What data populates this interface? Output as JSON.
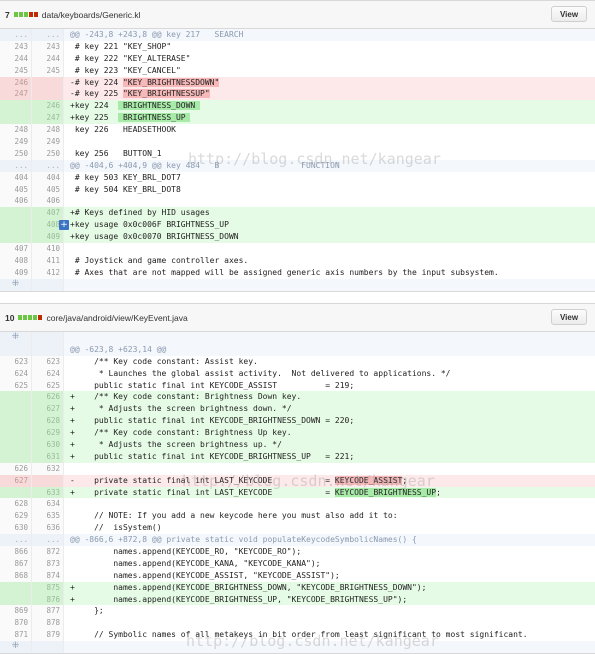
{
  "files": [
    {
      "count": "7",
      "bars": [
        "#6cc644",
        "#6cc644",
        "#6cc644",
        "#bd2c00",
        "#bd2c00"
      ],
      "path": "data/keyboards/Generic.kl",
      "view_label": "View",
      "rows": [
        {
          "t": "hunk",
          "o": "...",
          "n": "...",
          "c": "@@ -243,8 +243,8 @@ key 217   SEARCH"
        },
        {
          "t": "ctx",
          "o": "243",
          "n": "243",
          "c": " # key 221 \"KEY_SHOP\""
        },
        {
          "t": "ctx",
          "o": "244",
          "n": "244",
          "c": " # key 222 \"KEY_ALTERASE\""
        },
        {
          "t": "ctx",
          "o": "245",
          "n": "245",
          "c": " # key 223 \"KEY_CANCEL\""
        },
        {
          "t": "del",
          "o": "246",
          "n": "",
          "pre": "-# key 224 ",
          "hl": "\"KEY_BRIGHTNESSDOWN\"",
          "post": ""
        },
        {
          "t": "del",
          "o": "247",
          "n": "",
          "pre": "-# key 225 ",
          "hl": "\"KEY_BRIGHTNESSUP\"",
          "post": ""
        },
        {
          "t": "add",
          "o": "",
          "n": "246",
          "pre": "+key 224  ",
          "hl": " BRIGHTNESS_DOWN ",
          "post": ""
        },
        {
          "t": "add",
          "o": "",
          "n": "247",
          "pre": "+key 225  ",
          "hl": " BRIGHTNESS_UP ",
          "post": ""
        },
        {
          "t": "ctx",
          "o": "248",
          "n": "248",
          "c": " key 226   HEADSETHOOK"
        },
        {
          "t": "ctx",
          "o": "249",
          "n": "249",
          "c": ""
        },
        {
          "t": "ctx",
          "o": "250",
          "n": "250",
          "c": " key 256   BUTTON_1"
        },
        {
          "t": "hunk",
          "o": "...",
          "n": "...",
          "c": "@@ -404,6 +404,9 @@ key 484   B                 FUNCTION"
        },
        {
          "t": "ctx",
          "o": "404",
          "n": "404",
          "c": " # key 503 KEY_BRL_DOT7"
        },
        {
          "t": "ctx",
          "o": "405",
          "n": "405",
          "c": " # key 504 KEY_BRL_DOT8"
        },
        {
          "t": "ctx",
          "o": "406",
          "n": "406",
          "c": ""
        },
        {
          "t": "add",
          "o": "",
          "n": "407",
          "c": "+# Keys defined by HID usages"
        },
        {
          "t": "add",
          "o": "",
          "n": "408",
          "c": "+key usage 0x0c006F BRIGHTNESS_UP",
          "btn": true
        },
        {
          "t": "add",
          "o": "",
          "n": "409",
          "c": "+key usage 0x0c0070 BRIGHTNESS_DOWN"
        },
        {
          "t": "ctx",
          "o": "407",
          "n": "410",
          "c": ""
        },
        {
          "t": "ctx",
          "o": "408",
          "n": "411",
          "c": " # Joystick and game controller axes."
        },
        {
          "t": "ctx",
          "o": "409",
          "n": "412",
          "c": " # Axes that are not mapped will be assigned generic axis numbers by the input subsystem."
        },
        {
          "t": "exp",
          "o": "⁜",
          "n": "",
          "c": ""
        }
      ]
    },
    {
      "count": "10",
      "bars": [
        "#6cc644",
        "#6cc644",
        "#6cc644",
        "#6cc644",
        "#bd2c00"
      ],
      "path": "core/java/android/view/KeyEvent.java",
      "view_label": "View",
      "rows": [
        {
          "t": "exp",
          "o": "⁜",
          "n": "",
          "c": ""
        },
        {
          "t": "hunk",
          "o": "",
          "n": "",
          "c": "@@ -623,8 +623,14 @@"
        },
        {
          "t": "ctx",
          "o": "623",
          "n": "623",
          "c": "     /** Key code constant: Assist key."
        },
        {
          "t": "ctx",
          "o": "624",
          "n": "624",
          "c": "      * Launches the global assist activity.  Not delivered to applications. */"
        },
        {
          "t": "ctx",
          "o": "625",
          "n": "625",
          "c": "     public static final int KEYCODE_ASSIST          = 219;"
        },
        {
          "t": "add",
          "o": "",
          "n": "626",
          "c": "+    /** Key code constant: Brightness Down key."
        },
        {
          "t": "add",
          "o": "",
          "n": "627",
          "c": "+     * Adjusts the screen brightness down. */"
        },
        {
          "t": "add",
          "o": "",
          "n": "628",
          "c": "+    public static final int KEYCODE_BRIGHTNESS_DOWN = 220;"
        },
        {
          "t": "add",
          "o": "",
          "n": "629",
          "c": "+    /** Key code constant: Brightness Up key."
        },
        {
          "t": "add",
          "o": "",
          "n": "630",
          "c": "+     * Adjusts the screen brightness up. */"
        },
        {
          "t": "add",
          "o": "",
          "n": "631",
          "c": "+    public static final int KEYCODE_BRIGHTNESS_UP   = 221;"
        },
        {
          "t": "ctx",
          "o": "626",
          "n": "632",
          "c": ""
        },
        {
          "t": "del",
          "o": "627",
          "n": "",
          "pre": "-    private static final int LAST_KEYCODE           = ",
          "hl": "KEYCODE_ASSIST",
          "post": ";"
        },
        {
          "t": "add",
          "o": "",
          "n": "633",
          "pre": "+    private static final int LAST_KEYCODE           = ",
          "hl": "KEYCODE_BRIGHTNESS_UP",
          "post": ";"
        },
        {
          "t": "ctx",
          "o": "628",
          "n": "634",
          "c": ""
        },
        {
          "t": "ctx",
          "o": "629",
          "n": "635",
          "c": "     // NOTE: If you add a new keycode here you must also add it to:"
        },
        {
          "t": "ctx",
          "o": "630",
          "n": "636",
          "c": "     //  isSystem()"
        },
        {
          "t": "hunk",
          "o": "...",
          "n": "...",
          "c": "@@ -866,6 +872,8 @@ private static void populateKeycodeSymbolicNames() {"
        },
        {
          "t": "ctx",
          "o": "866",
          "n": "872",
          "c": "         names.append(KEYCODE_RO, \"KEYCODE_RO\");"
        },
        {
          "t": "ctx",
          "o": "867",
          "n": "873",
          "c": "         names.append(KEYCODE_KANA, \"KEYCODE_KANA\");"
        },
        {
          "t": "ctx",
          "o": "868",
          "n": "874",
          "c": "         names.append(KEYCODE_ASSIST, \"KEYCODE_ASSIST\");"
        },
        {
          "t": "add",
          "o": "",
          "n": "875",
          "c": "+        names.append(KEYCODE_BRIGHTNESS_DOWN, \"KEYCODE_BRIGHTNESS_DOWN\");"
        },
        {
          "t": "add",
          "o": "",
          "n": "876",
          "c": "+        names.append(KEYCODE_BRIGHTNESS_UP, \"KEYCODE_BRIGHTNESS_UP\");"
        },
        {
          "t": "ctx",
          "o": "869",
          "n": "877",
          "c": "     };"
        },
        {
          "t": "ctx",
          "o": "870",
          "n": "878",
          "c": ""
        },
        {
          "t": "ctx",
          "o": "871",
          "n": "879",
          "c": "     // Symbolic names of all metakeys in bit order from least significant to most significant."
        },
        {
          "t": "exp",
          "o": "⁜",
          "n": "",
          "c": ""
        }
      ]
    }
  ],
  "watermarks": [
    "http://blog.csdn.net/kangear",
    "http://blog.csdn.net/kangear",
    "http://blog.csdn.net/kangear"
  ]
}
